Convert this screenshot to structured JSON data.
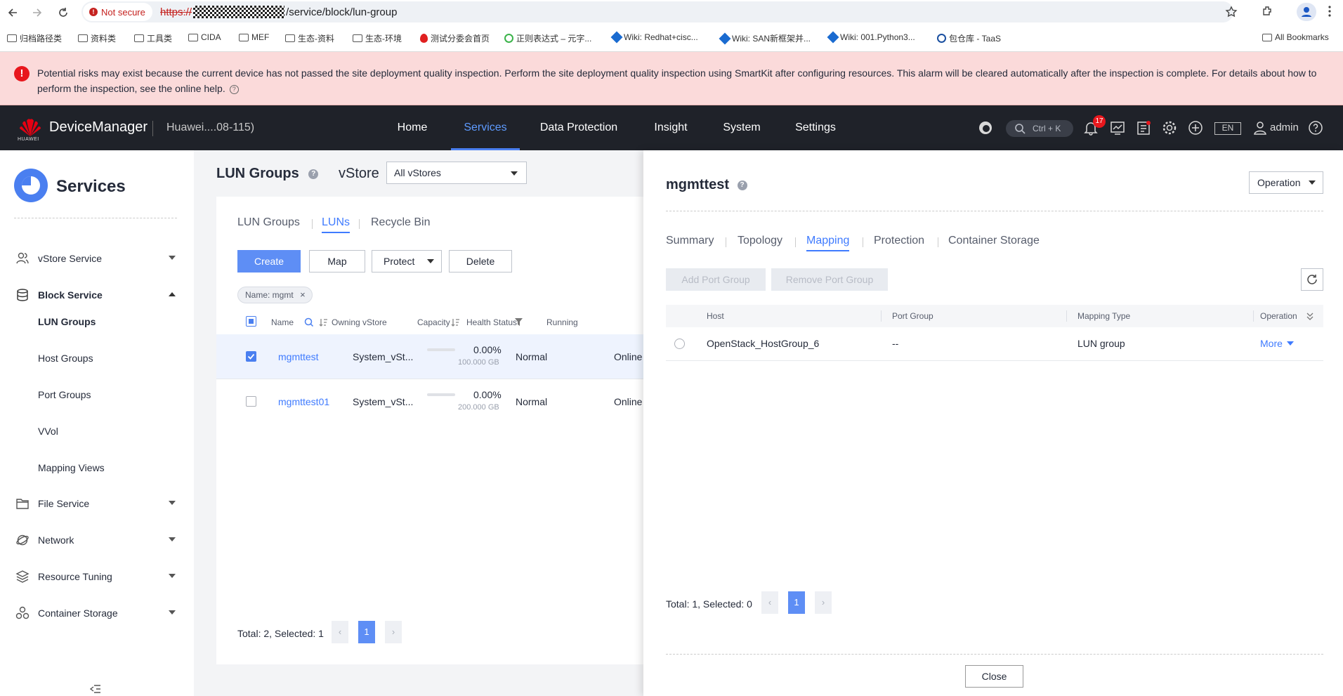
{
  "browser": {
    "security_label": "Not secure",
    "url_scheme": "https://",
    "url_path": "/service/block/lun-group",
    "bookmarks": [
      {
        "label": "归档路径类"
      },
      {
        "label": "资料类"
      },
      {
        "label": "工具类"
      },
      {
        "label": "CIDA"
      },
      {
        "label": "MEF"
      },
      {
        "label": "生态-资料"
      },
      {
        "label": "生态-环境"
      },
      {
        "label": "测试分委会首页"
      },
      {
        "label": "正则表达式 – 元字..."
      },
      {
        "label": "Wiki: Redhat+cisc..."
      },
      {
        "label": "Wiki: SAN新框架并..."
      },
      {
        "label": "Wiki: 001.Python3..."
      },
      {
        "label": "包仓库 - TaaS"
      }
    ],
    "all_bookmarks": "All Bookmarks"
  },
  "warning": {
    "text": "Potential risks may exist because the current device has not passed the site deployment quality inspection. Perform the site deployment quality inspection using SmartKit after configuring resources. This alarm will be cleared automatically after the inspection is complete. For details about how to perform the inspection, see the online help."
  },
  "topnav": {
    "logo_text": "HUAWEI",
    "product": "DeviceManager",
    "device": "Huawei....08-115)",
    "items": [
      {
        "label": "Home"
      },
      {
        "label": "Services"
      },
      {
        "label": "Data Protection"
      },
      {
        "label": "Insight"
      },
      {
        "label": "System"
      },
      {
        "label": "Settings"
      }
    ],
    "search_shortcut": "Ctrl + K",
    "notification_count": "17",
    "lang": "EN",
    "user": "admin",
    "accent": "#4a7ff0"
  },
  "sidebar": {
    "title": "Services",
    "sections": [
      {
        "label": "vStore Service",
        "icon": "users-icon"
      },
      {
        "label": "Block Service",
        "icon": "database-icon"
      },
      {
        "label": "File Service",
        "icon": "folder-icon"
      },
      {
        "label": "Network",
        "icon": "globe-icon"
      },
      {
        "label": "Resource Tuning",
        "icon": "layers-icon"
      },
      {
        "label": "Container Storage",
        "icon": "containers-icon"
      }
    ],
    "block_items": [
      {
        "label": "LUN Groups"
      },
      {
        "label": "Host Groups"
      },
      {
        "label": "Port Groups"
      },
      {
        "label": "VVol"
      },
      {
        "label": "Mapping Views"
      }
    ]
  },
  "main": {
    "title": "LUN Groups",
    "vstore_label": "vStore",
    "vstore_value": "All vStores",
    "tabs": [
      {
        "label": "LUN Groups"
      },
      {
        "label": "LUNs"
      },
      {
        "label": "Recycle Bin"
      }
    ],
    "buttons": {
      "create": "Create",
      "map": "Map",
      "protect": "Protect",
      "delete": "Delete"
    },
    "filter_tag": "Name: mgmt",
    "columns": {
      "name": "Name",
      "owning_vstore": "Owning vStore",
      "capacity": "Capacity",
      "health": "Health Status",
      "running": "Running"
    },
    "rows": [
      {
        "name": "mgmttest",
        "vstore": "System_vSt...",
        "capacity_pct": "0.00%",
        "capacity_total": "100.000 GB",
        "health": "Normal",
        "running": "Online",
        "selected": true
      },
      {
        "name": "mgmttest01",
        "vstore": "System_vSt...",
        "capacity_pct": "0.00%",
        "capacity_total": "200.000 GB",
        "health": "Normal",
        "running": "Online",
        "selected": false
      }
    ],
    "pagination": {
      "summary": "Total: 2, Selected: 1",
      "page": "1"
    }
  },
  "drawer": {
    "title": "mgmttest",
    "operation": "Operation",
    "tabs": [
      {
        "label": "Summary"
      },
      {
        "label": "Topology"
      },
      {
        "label": "Mapping"
      },
      {
        "label": "Protection"
      },
      {
        "label": "Container Storage"
      }
    ],
    "buttons": {
      "add_port_group": "Add Port Group",
      "remove_port_group": "Remove Port Group"
    },
    "columns": {
      "host": "Host",
      "port_group": "Port Group",
      "mapping_type": "Mapping Type",
      "operation": "Operation"
    },
    "rows": [
      {
        "host": "OpenStack_HostGroup_6",
        "port_group": "--",
        "mapping_type": "LUN group",
        "operation": "More"
      }
    ],
    "pagination": {
      "summary": "Total: 1, Selected: 0",
      "page": "1"
    },
    "close": "Close"
  }
}
